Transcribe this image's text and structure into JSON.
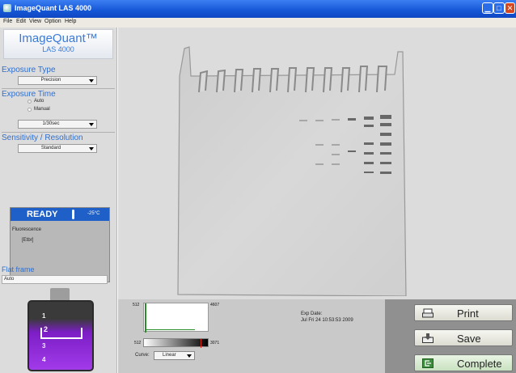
{
  "window": {
    "title": "ImageQuant LAS 4000"
  },
  "menu": [
    "File",
    "Edit",
    "View",
    "Option",
    "Help"
  ],
  "logo": {
    "line1": "ImageQuant™",
    "line2": "LAS 4000"
  },
  "exposure_type": {
    "title": "Exposure Type",
    "value": "Precision"
  },
  "exposure_time": {
    "title": "Exposure Time",
    "auto_label": "Auto",
    "manual_label": "Manual",
    "selected": "Manual",
    "value": "1/30sec"
  },
  "sensitivity": {
    "title": "Sensitivity / Resolution",
    "value": "Standard"
  },
  "status": {
    "label": "READY",
    "temperature": "-25°C",
    "mode": "Fluorescence",
    "filter": "[Etbr]"
  },
  "flat_frame": {
    "title": "Flat frame",
    "value": "Auto"
  },
  "tray": {
    "slots": [
      "1",
      "2",
      "3",
      "4"
    ],
    "selected": "2"
  },
  "histogram": {
    "min": "512",
    "max": "4607"
  },
  "gradient": {
    "min": "512",
    "max": "3071"
  },
  "curve": {
    "label": "Curve:",
    "value": "Linear"
  },
  "exposure_date": {
    "label": "Exp Date:",
    "value": "Jul Fri 24 10:53:53 2009"
  },
  "actions": {
    "print": "Print",
    "save": "Save",
    "complete": "Complete"
  },
  "colors": {
    "accent_blue": "#2f6fd0",
    "ready_bar": "#1e5fc8",
    "tray_purple": "#a23bea"
  }
}
